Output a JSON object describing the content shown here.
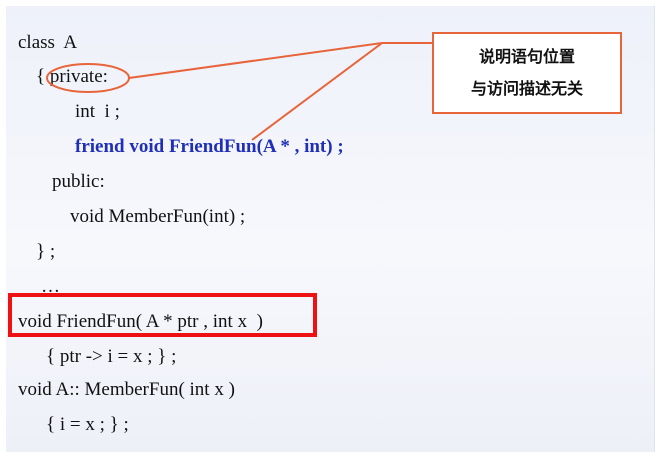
{
  "code": {
    "l1": "class  A",
    "l2a": "{ ",
    "l2b": "private:",
    "l3": "int  i ;",
    "l4": "friend void FriendFun(A * , int) ;",
    "l5": "public:",
    "l6": "void MemberFun(int) ;",
    "l7": "} ;",
    "l8": "…",
    "l9": "void FriendFun( A * ptr , int x  )",
    "l10": "{ ptr -> i = x ; } ;",
    "l11": "void A:: MemberFun( int x )",
    "l12": "{ i = x ; } ;"
  },
  "callout": {
    "line1": "说明语句位置",
    "line2": "与访问描述无关"
  },
  "colors": {
    "accent_line": "#e8643a",
    "highlight_box": "#ee1111",
    "keyword_blue": "#1f2fb8"
  }
}
